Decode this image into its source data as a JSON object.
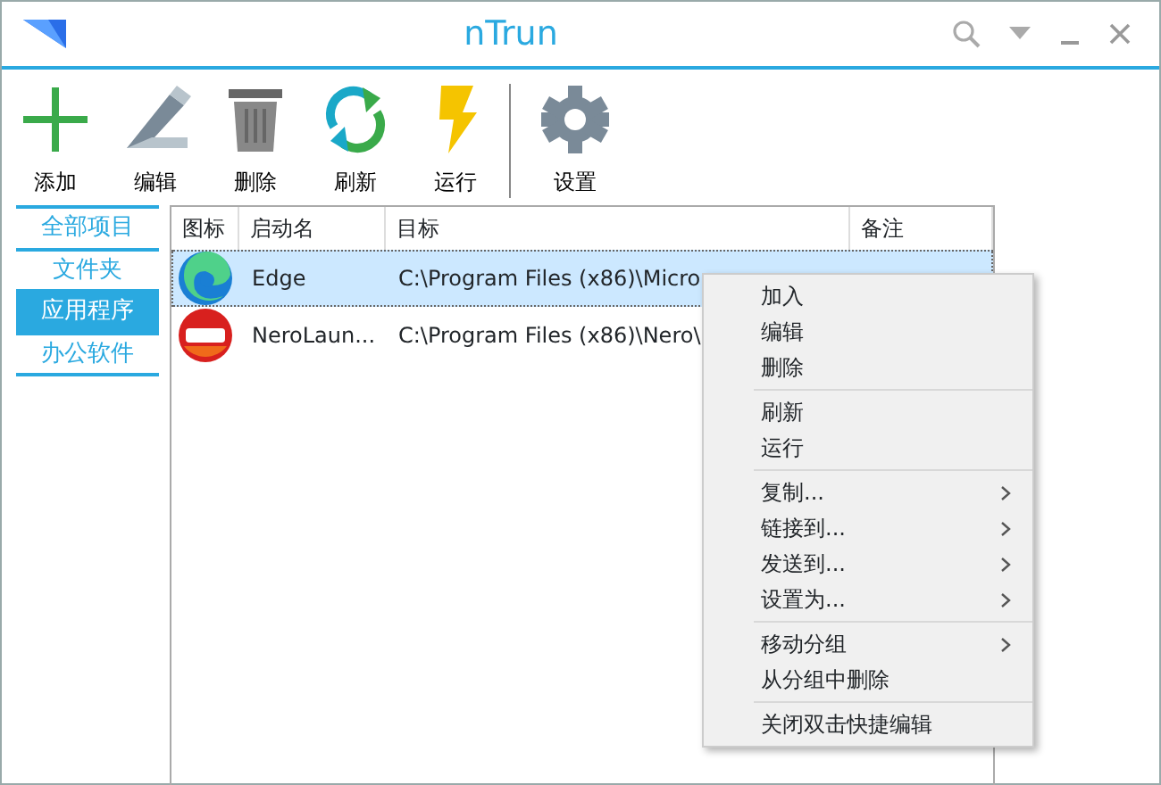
{
  "window": {
    "title": "nTrun"
  },
  "toolbar": [
    {
      "label": "添加",
      "kind": "add"
    },
    {
      "label": "编辑",
      "kind": "edit"
    },
    {
      "label": "删除",
      "kind": "delete"
    },
    {
      "label": "刷新",
      "kind": "refresh"
    },
    {
      "label": "运行",
      "kind": "run"
    },
    {
      "label": "设置",
      "kind": "settings"
    }
  ],
  "sidebar": {
    "items": [
      {
        "label": "全部项目",
        "selected": false
      },
      {
        "label": "文件夹",
        "selected": false
      },
      {
        "label": "应用程序",
        "selected": true
      },
      {
        "label": "办公软件",
        "selected": false
      }
    ]
  },
  "table": {
    "columns": [
      "图标",
      "启动名",
      "目标",
      "备注"
    ],
    "rows": [
      {
        "kind": "edge",
        "name": "Edge",
        "target": "C:\\Program Files (x86)\\Micro",
        "selected": true
      },
      {
        "kind": "nero",
        "name": "NeroLaun...",
        "target": "C:\\Program Files (x86)\\Nero\\",
        "selected": false
      }
    ]
  },
  "context_menu": {
    "groups": [
      [
        {
          "label": "加入",
          "submenu": false
        },
        {
          "label": "编辑",
          "submenu": false
        },
        {
          "label": "删除",
          "submenu": false
        }
      ],
      [
        {
          "label": "刷新",
          "submenu": false
        },
        {
          "label": "运行",
          "submenu": false
        }
      ],
      [
        {
          "label": "复制...",
          "submenu": true
        },
        {
          "label": "链接到...",
          "submenu": true
        },
        {
          "label": "发送到...",
          "submenu": true
        },
        {
          "label": "设置为...",
          "submenu": true
        }
      ],
      [
        {
          "label": "移动分组",
          "submenu": true
        },
        {
          "label": "从分组中删除",
          "submenu": false
        }
      ],
      [
        {
          "label": "关闭双击快捷编辑",
          "submenu": false
        }
      ]
    ]
  }
}
